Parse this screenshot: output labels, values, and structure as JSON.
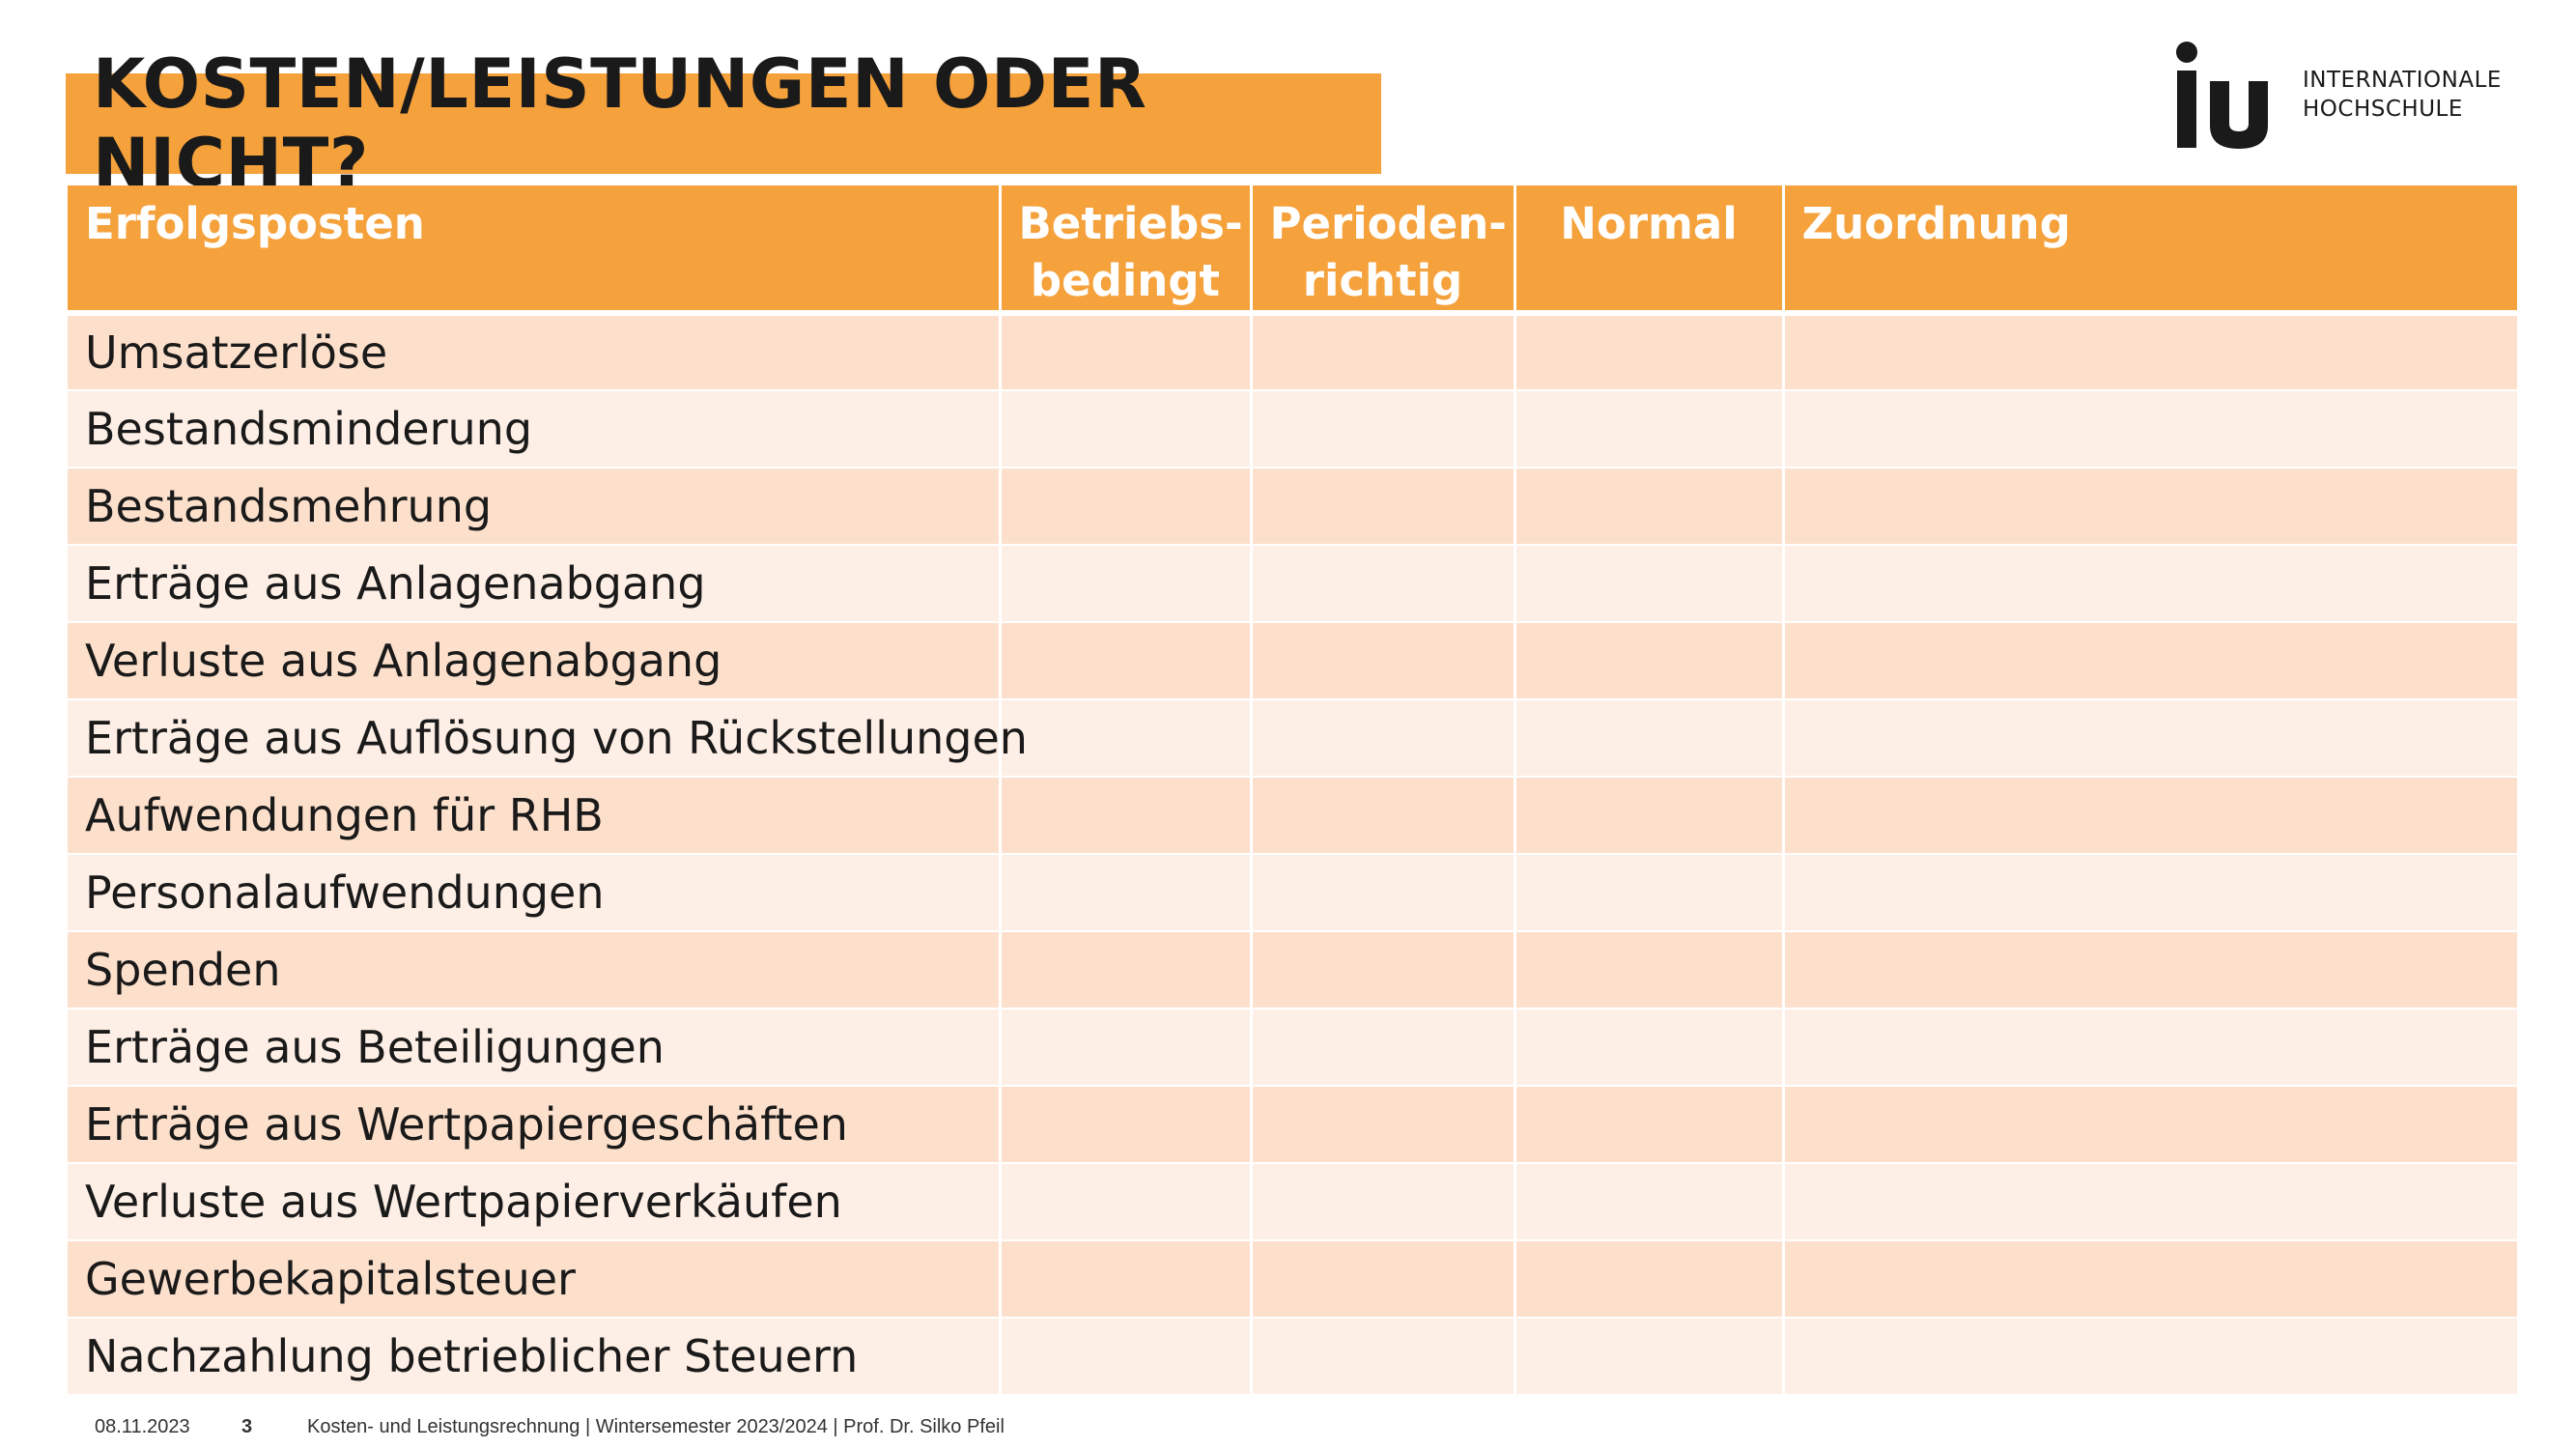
{
  "title": "KOSTEN/LEISTUNGEN ODER NICHT?",
  "logo": {
    "mark": "iu",
    "line1": "INTERNATIONALE",
    "line2": "HOCHSCHULE"
  },
  "colors": {
    "accent": "#f5a13c",
    "row_odd": "#fde0cc",
    "row_even": "#feefe6"
  },
  "table": {
    "headers": [
      {
        "line1": "Erfolgsposten",
        "line2": ""
      },
      {
        "line1": "Betriebs-",
        "line2": "bedingt"
      },
      {
        "line1": "Perioden-",
        "line2": "richtig"
      },
      {
        "line1": "Normal",
        "line2": ""
      },
      {
        "line1": "Zuordnung",
        "line2": ""
      }
    ],
    "rows": [
      "Umsatzerlöse",
      "Bestandsminderung",
      "Bestandsmehrung",
      "Erträge aus Anlagenabgang",
      "Verluste aus Anlagenabgang",
      "Erträge aus Auflösung von Rückstellungen",
      "Aufwendungen für RHB",
      "Personalaufwendungen",
      "Spenden",
      "Erträge aus Beteiligungen",
      "Erträge aus Wertpapiergeschäften",
      "Verluste aus Wertpapierverkäufen",
      "Gewerbekapitalsteuer",
      "Nachzahlung betrieblicher Steuern"
    ]
  },
  "footer": {
    "date": "08.11.2023",
    "page": "3",
    "course": "Kosten- und Leistungsrechnung | Wintersemester 2023/2024 | Prof. Dr. Silko Pfeil"
  }
}
